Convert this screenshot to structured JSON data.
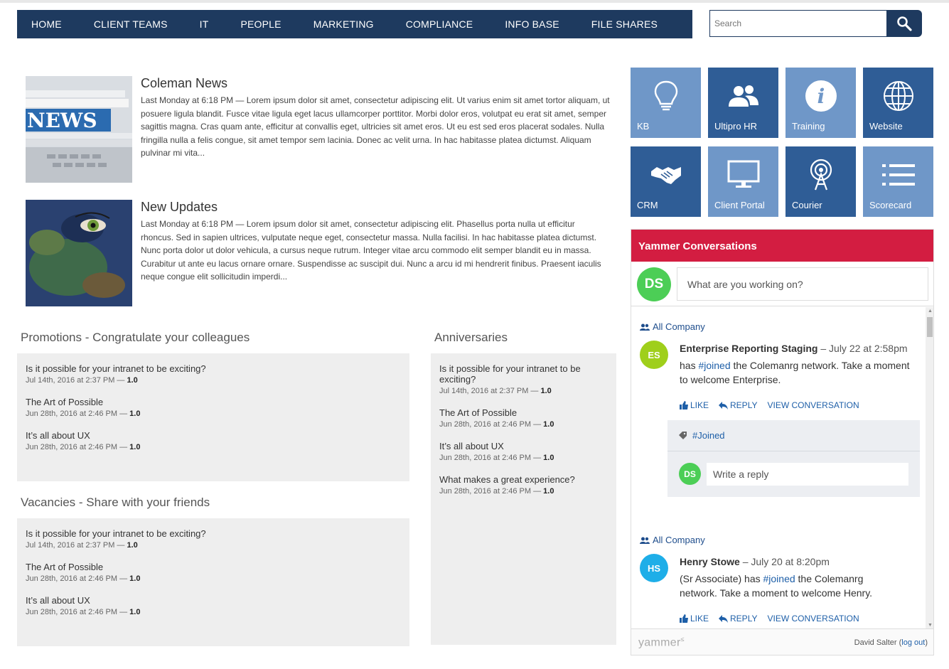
{
  "nav": {
    "items": [
      "HOME",
      "CLIENT TEAMS",
      "IT",
      "PEOPLE",
      "MARKETING",
      "COMPLIANCE",
      "INFO BASE",
      "FILE SHARES"
    ],
    "search_placeholder": "Search"
  },
  "news": [
    {
      "title": "Coleman News",
      "body": "Last Monday at 6:18 PM — Lorem ipsum dolor sit amet, consectetur adipiscing elit. Ut varius enim sit amet tortor aliquam, ut posuere ligula blandit. Fusce vitae ligula eget lacus ullamcorper porttitor. Morbi dolor eros, volutpat eu erat sit amet, semper sagittis magna. Cras quam ante, efficitur at convallis eget, ultricies sit amet eros. Ut eu est sed eros placerat sodales. Nulla fringilla nulla a felis congue, sit amet tempor sem lacinia. Donec ac velit urna. In hac habitasse platea dictumst. Aliquam pulvinar mi vita...",
      "image_text": "NEWS"
    },
    {
      "title": "New Updates",
      "body": "Last Monday at 6:18 PM — Lorem ipsum dolor sit amet, consectetur adipiscing elit. Phasellus porta nulla ut efficitur rhoncus. Sed in sapien ultrices, vulputate neque eget, consectetur massa. Nulla facilisi. In hac habitasse platea dictumst. Nunc porta dolor ut dolor vehicula, a cursus neque rutrum. Integer vitae arcu commodo elit semper blandit eu in massa. Curabitur ut ante eu lacus ornare ornare. Suspendisse ac suscipit dui. Nunc a arcu id mi hendrerit finibus. Praesent iaculis neque congue elit sollicitudin imperdi..."
    }
  ],
  "promotions": {
    "title": "Promotions - Congratulate your colleagues",
    "items": [
      {
        "title": "Is it possible for your intranet to be exciting?",
        "meta": "Jul 14th, 2016 at 2:37 PM — ",
        "version": "1.0"
      },
      {
        "title": "The Art of Possible",
        "meta": "Jun 28th, 2016 at 2:46 PM — ",
        "version": "1.0"
      },
      {
        "title": "It’s all about UX",
        "meta": "Jun 28th, 2016 at 2:46 PM — ",
        "version": "1.0"
      }
    ]
  },
  "vacancies": {
    "title": "Vacancies - Share with your friends",
    "items": [
      {
        "title": "Is it possible for your intranet to be exciting?",
        "meta": "Jul 14th, 2016 at 2:37 PM — ",
        "version": "1.0"
      },
      {
        "title": "The Art of Possible",
        "meta": "Jun 28th, 2016 at 2:46 PM — ",
        "version": "1.0"
      },
      {
        "title": "It’s all about UX",
        "meta": "Jun 28th, 2016 at 2:46 PM — ",
        "version": "1.0"
      }
    ]
  },
  "anniversaries": {
    "title": "Anniversaries",
    "items": [
      {
        "title": "Is it possible for your intranet to be exciting?",
        "meta": "Jul 14th, 2016 at 2:37 PM — ",
        "version": "1.0"
      },
      {
        "title": "The Art of Possible",
        "meta": "Jun 28th, 2016 at 2:46 PM — ",
        "version": "1.0"
      },
      {
        "title": "It’s all about UX",
        "meta": "Jun 28th, 2016 at 2:46 PM — ",
        "version": "1.0"
      },
      {
        "title": "What makes a great experience?",
        "meta": "Jun 28th, 2016 at 2:46 PM — ",
        "version": "1.0"
      }
    ]
  },
  "tiles": [
    {
      "label": "KB",
      "icon": "lightbulb-icon",
      "shade": "light"
    },
    {
      "label": "Ultipro HR",
      "icon": "people-icon",
      "shade": "dark"
    },
    {
      "label": "Training",
      "icon": "info-icon",
      "shade": "light"
    },
    {
      "label": "Website",
      "icon": "globe-icon",
      "shade": "dark"
    },
    {
      "label": "CRM",
      "icon": "handshake-icon",
      "shade": "dark"
    },
    {
      "label": "Client Portal",
      "icon": "monitor-icon",
      "shade": "light"
    },
    {
      "label": "Courier",
      "icon": "antenna-icon",
      "shade": "dark"
    },
    {
      "label": "Scorecard",
      "icon": "list-icon",
      "shade": "light"
    }
  ],
  "yammer": {
    "title": "Yammer Conversations",
    "me_initials": "DS",
    "compose_placeholder": "What are you working on?",
    "posts": [
      {
        "group": "All Company",
        "initials": "ES",
        "avatar_color": "#9fcf1b",
        "author": "Enterprise Reporting Staging",
        "time": " – July 22 at 2:58pm",
        "text_pre": "has ",
        "hashtag": "#joined",
        "text_post": " the Colemanrg network. Take a moment to welcome Enterprise.",
        "topic": "#Joined",
        "reply_placeholder": "Write a reply"
      },
      {
        "group": "All Company",
        "initials": "HS",
        "avatar_color": "#1eaee8",
        "author": "Henry Stowe",
        "time": " – July 20 at 8:20pm",
        "text_pre": "(Sr Associate) has ",
        "hashtag": "#joined",
        "text_post": " the Colemanrg network. Take a moment to welcome Henry."
      }
    ],
    "actions": {
      "like": "LIKE",
      "reply": "REPLY",
      "view": "VIEW CONVERSATION"
    },
    "footer_logo": "yammer",
    "footer_user": "David Salter",
    "footer_logout": "log out"
  },
  "colors": {
    "nav": "#1e3a5f",
    "tile_light": "#6f97c8",
    "tile_dark": "#2f5d96",
    "yammer_red": "#d31d41",
    "link": "#1e5fa8",
    "me_avatar": "#4cce56"
  }
}
